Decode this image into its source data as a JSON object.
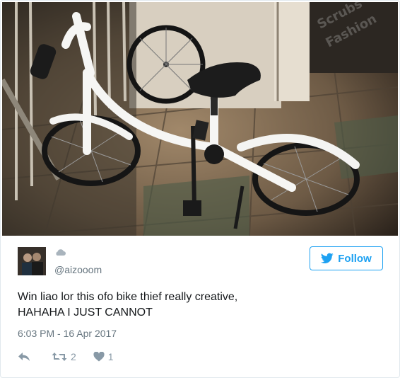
{
  "tweet": {
    "handle": "@aizooom",
    "text_line1": "Win liao lor this ofo bike thief really creative,",
    "text_line2": "HAHAHA I JUST CANNOT",
    "timestamp": "6:03 PM - 16 Apr 2017",
    "follow_label": "Follow",
    "retweet_count": "2",
    "like_count": "1"
  },
  "photo": {
    "watermark_line1": "Scrubs",
    "watermark_line2": "Fashion"
  },
  "colors": {
    "brand_blue": "#1da1f2",
    "text_primary": "#14171a",
    "text_secondary": "#66757f",
    "action_gray": "#8899a6"
  },
  "icons": [
    "cloud-icon",
    "bird-icon",
    "reply-icon",
    "retweet-icon",
    "heart-icon"
  ]
}
